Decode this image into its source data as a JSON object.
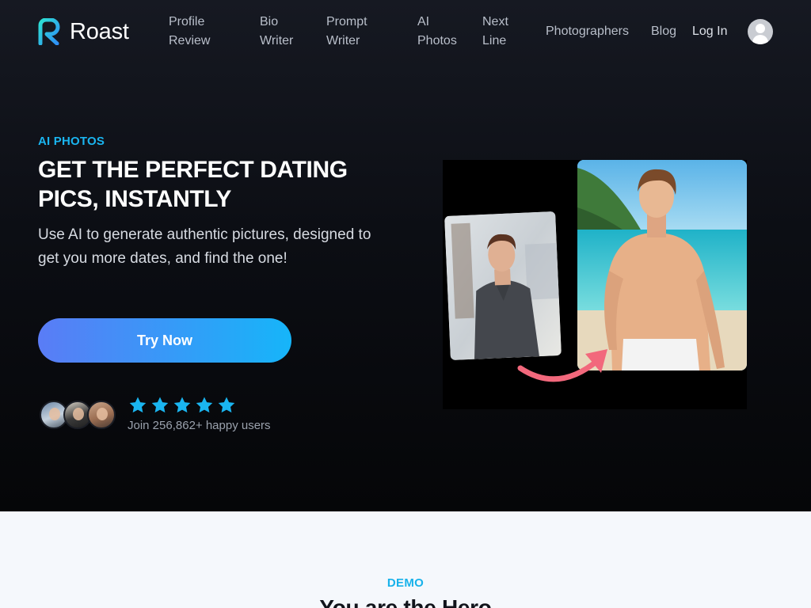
{
  "brand": {
    "name": "Roast",
    "logo_icon": "roast-r-logo",
    "accent": "#1ab5f0"
  },
  "nav": {
    "items": [
      {
        "label_line1": "Profile",
        "label_line2": "Review"
      },
      {
        "label_line1": "Bio",
        "label_line2": "Writer"
      },
      {
        "label_line1": "Prompt",
        "label_line2": "Writer"
      },
      {
        "label_line1": "AI",
        "label_line2": "Photos"
      },
      {
        "label_line1": "Next",
        "label_line2": "Line"
      }
    ],
    "photographers": "Photographers",
    "blog": "Blog",
    "login": "Log In",
    "account_icon": "user-avatar-icon"
  },
  "hero": {
    "eyebrow": "AI PHOTOS",
    "headline_line1": "GET THE PERFECT DATING",
    "headline_line2": "PICS, INSTANTLY",
    "subtext": "Use AI to generate authentic pictures, designed to get you more dates, and find the one!",
    "cta_label": "Try Now",
    "cta_gradient": [
      "#5a7cf6",
      "#16b5f9"
    ],
    "rating_stars": 5,
    "star_color": "#1ab5f0",
    "social_proof": "Join 256,862+ happy users",
    "arrow_color": "#f2687c"
  },
  "demo": {
    "eyebrow": "DEMO",
    "title": "You are the Hero"
  }
}
